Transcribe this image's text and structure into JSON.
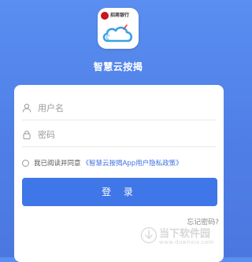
{
  "app": {
    "bank_name": "招商银行",
    "name": "智慧云按揭"
  },
  "login": {
    "username_placeholder": "用户名",
    "password_placeholder": "密码",
    "agree_text": "我已阅读并同意",
    "policy_link": "《智慧云按揭App用户隐私政策》",
    "login_label": "登 录",
    "forgot_label": "忘记密码?"
  },
  "watermark": {
    "text": "当下软件园",
    "sub": "www.downxia.com"
  },
  "colors": {
    "background": "#5a8ef0",
    "primary": "#3f76e8",
    "link": "#3d6fe0",
    "bank_red": "#c8161d"
  },
  "icons": {
    "username": "user-icon",
    "password": "lock-icon",
    "agree": "radio-icon"
  }
}
